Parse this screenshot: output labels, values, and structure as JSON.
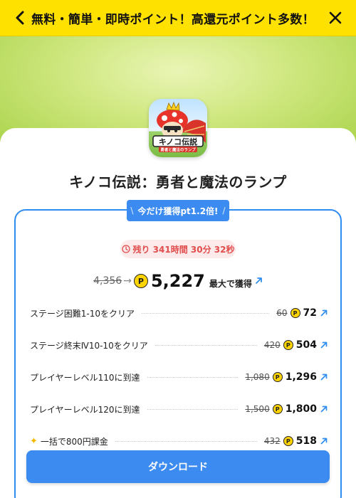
{
  "header": {
    "title": "無料・簡単・即時ポイント！高還元ポイント多数！"
  },
  "app": {
    "title": "キノコ伝説：勇者と魔法のランプ",
    "icon_text": "キノコ伝説",
    "icon_subtext": "勇者と魔法のランプ"
  },
  "bonus": {
    "label": "今だけ獲得pt1.2倍!"
  },
  "remaining": {
    "label": "残り 341時間 30分 32秒"
  },
  "total": {
    "old": "4,356",
    "new": "5,227",
    "suffix": "最大で獲得"
  },
  "tasks": [
    {
      "label": "ステージ困難1-10をクリア",
      "old": "60",
      "new": "72"
    },
    {
      "label": "ステージ終末Ⅳ10-10をクリア",
      "old": "420",
      "new": "504"
    },
    {
      "label": "プレイヤーレベル110に到達",
      "old": "1,080",
      "new": "1,296"
    },
    {
      "label": "プレイヤーレベル120に到達",
      "old": "1,500",
      "new": "1,800"
    },
    {
      "label": "一括で800円課金",
      "old": "432",
      "new": "518"
    }
  ],
  "coin_symbol": "P",
  "download": {
    "label": "ダウンロード"
  },
  "colors": {
    "topbar": "#ffe100",
    "accent_blue": "#3b8bf0",
    "remaining_red": "#e24c4c",
    "coin_yellow": "#ffd400"
  }
}
